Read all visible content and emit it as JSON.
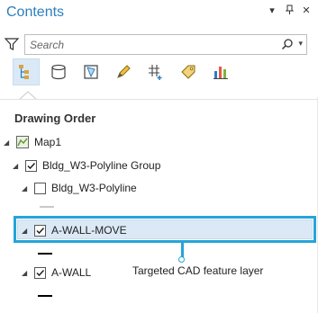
{
  "window": {
    "title": "Contents",
    "controls": [
      "▾",
      "⊓",
      "✕"
    ]
  },
  "search": {
    "placeholder": "Search"
  },
  "toolbar": {
    "tools": [
      "list-by-drawing-order-icon",
      "list-by-data-source-icon",
      "list-by-selection-icon",
      "list-by-editing-icon",
      "list-by-snapping-icon",
      "list-by-labeling-icon",
      "list-by-charts-icon"
    ],
    "active_index": 0
  },
  "section": {
    "title": "Drawing Order"
  },
  "tree": {
    "map": {
      "label": "Map1",
      "expander": "◢"
    },
    "group": {
      "label": "Bldg_W3-Polyline Group",
      "expander": "◢",
      "checked": true
    },
    "layer1": {
      "label": "Bldg_W3-Polyline",
      "expander": "◢",
      "checked": false,
      "symbol_color": "#c8c8c8"
    },
    "layer2": {
      "label": "A-WALL-MOVE",
      "expander": "◢",
      "checked": true,
      "symbol_color": "#000000",
      "selected": true
    },
    "layer3": {
      "label": "A-WALL",
      "expander": "◢",
      "checked": true,
      "symbol_color": "#000000"
    }
  },
  "callout": {
    "text": "Targeted CAD feature layer",
    "color": "#26a4d9"
  }
}
